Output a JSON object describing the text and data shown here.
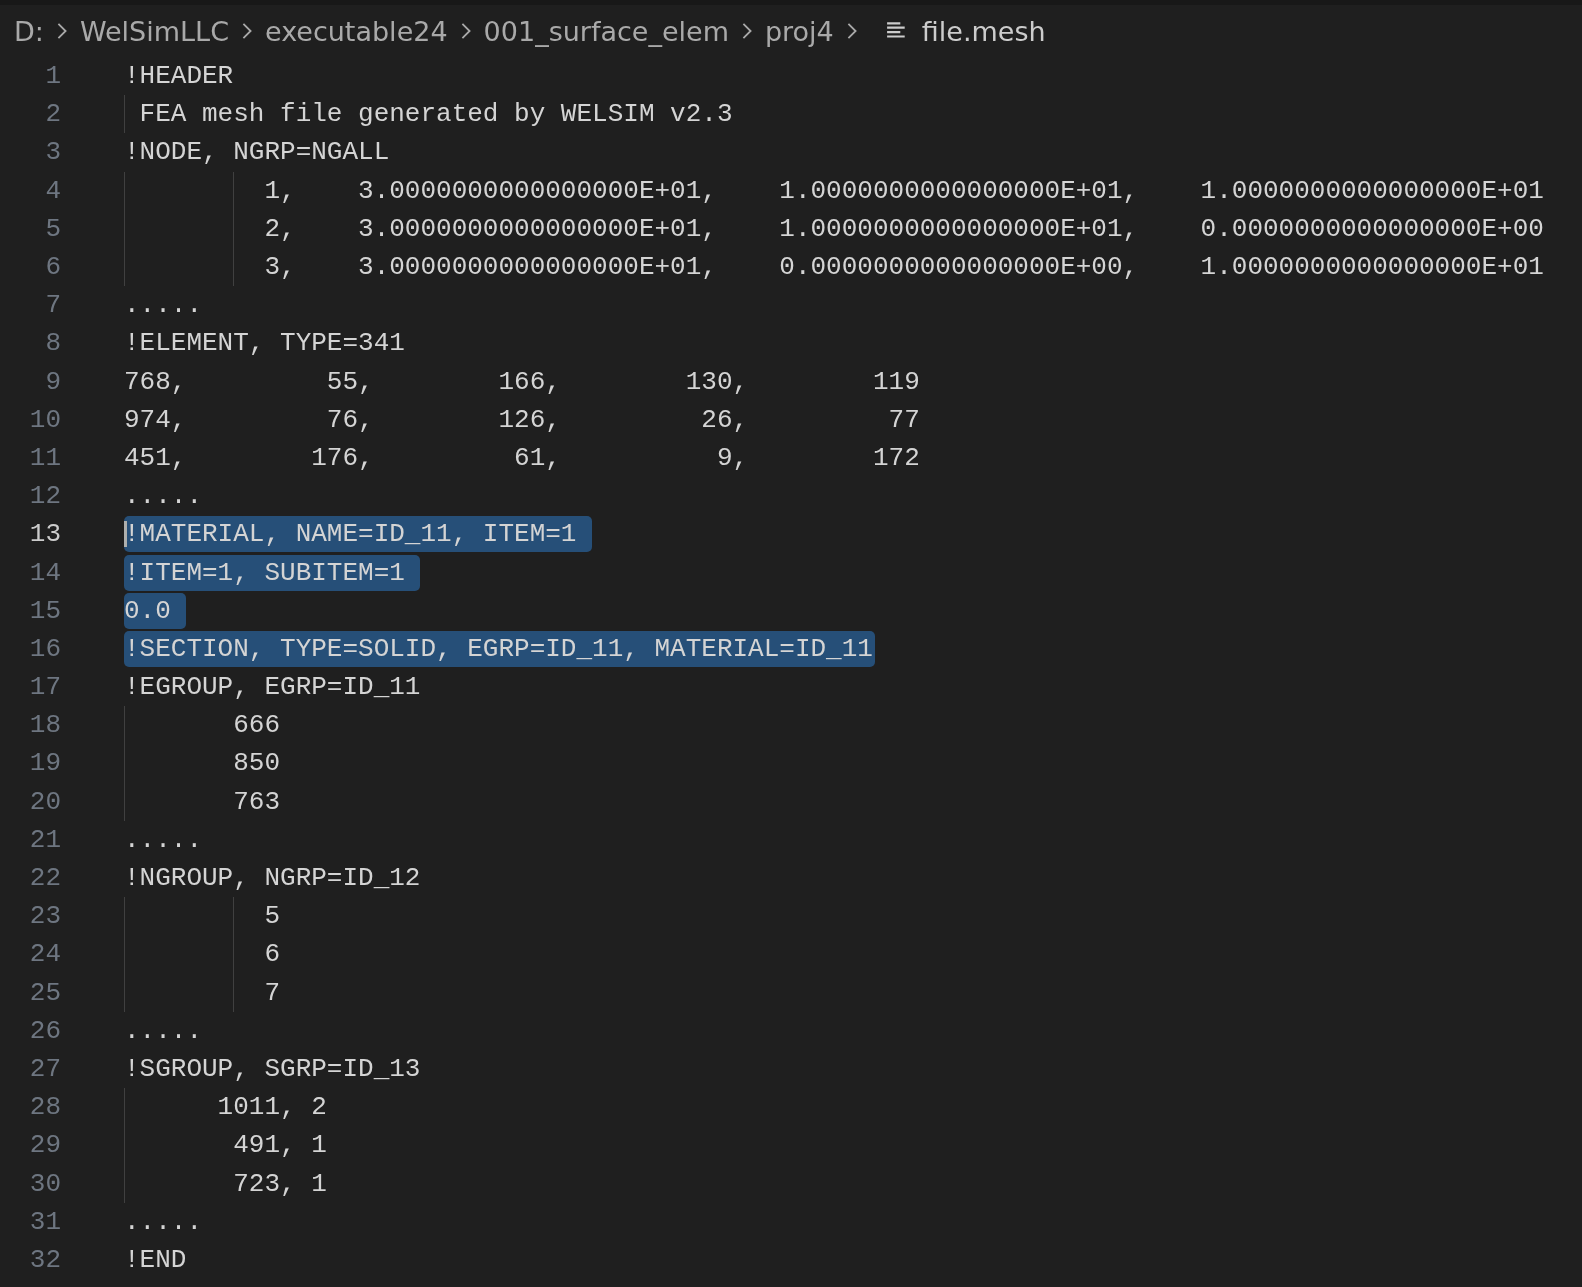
{
  "breadcrumb": [
    {
      "label": "D:",
      "kind": "folder"
    },
    {
      "label": "WelSimLLC",
      "kind": "folder"
    },
    {
      "label": "executable24",
      "kind": "folder"
    },
    {
      "label": "001_surface_elem",
      "kind": "folder"
    },
    {
      "label": "proj4",
      "kind": "folder"
    },
    {
      "label": "file.mesh",
      "kind": "file"
    }
  ],
  "lines": [
    {
      "number": "1",
      "text": "!HEADER",
      "selected": false,
      "active": false
    },
    {
      "number": "2",
      "text": " FEA mesh file generated by WELSIM v2.3",
      "selected": false,
      "active": false
    },
    {
      "number": "3",
      "text": "!NODE, NGRP=NGALL",
      "selected": false,
      "active": false
    },
    {
      "number": "4",
      "text": "         1,    3.0000000000000000E+01,    1.0000000000000000E+01,    1.0000000000000000E+01",
      "selected": false,
      "active": false
    },
    {
      "number": "5",
      "text": "         2,    3.0000000000000000E+01,    1.0000000000000000E+01,    0.0000000000000000E+00",
      "selected": false,
      "active": false
    },
    {
      "number": "6",
      "text": "         3,    3.0000000000000000E+01,    0.0000000000000000E+00,    1.0000000000000000E+01",
      "selected": false,
      "active": false
    },
    {
      "number": "7",
      "text": ".....",
      "selected": false,
      "active": false
    },
    {
      "number": "8",
      "text": "!ELEMENT, TYPE=341",
      "selected": false,
      "active": false
    },
    {
      "number": "9",
      "text": "768,         55,        166,        130,        119",
      "selected": false,
      "active": false
    },
    {
      "number": "10",
      "text": "974,         76,        126,         26,         77",
      "selected": false,
      "active": false
    },
    {
      "number": "11",
      "text": "451,        176,         61,          9,        172",
      "selected": false,
      "active": false
    },
    {
      "number": "12",
      "text": ".....",
      "selected": false,
      "active": false
    },
    {
      "number": "13",
      "text": "!MATERIAL, NAME=ID_11, ITEM=1",
      "selected": true,
      "active": true
    },
    {
      "number": "14",
      "text": "!ITEM=1, SUBITEM=1",
      "selected": true,
      "active": false
    },
    {
      "number": "15",
      "text": "0.0",
      "selected": true,
      "active": false
    },
    {
      "number": "16",
      "text": "!SECTION, TYPE=SOLID, EGRP=ID_11, MATERIAL=ID_11",
      "selected": true,
      "active": false
    },
    {
      "number": "17",
      "text": "!EGROUP, EGRP=ID_11",
      "selected": false,
      "active": false
    },
    {
      "number": "18",
      "text": "       666",
      "selected": false,
      "active": false
    },
    {
      "number": "19",
      "text": "       850",
      "selected": false,
      "active": false
    },
    {
      "number": "20",
      "text": "       763",
      "selected": false,
      "active": false
    },
    {
      "number": "21",
      "text": ".....",
      "selected": false,
      "active": false
    },
    {
      "number": "22",
      "text": "!NGROUP, NGRP=ID_12",
      "selected": false,
      "active": false
    },
    {
      "number": "23",
      "text": "         5",
      "selected": false,
      "active": false
    },
    {
      "number": "24",
      "text": "         6",
      "selected": false,
      "active": false
    },
    {
      "number": "25",
      "text": "         7",
      "selected": false,
      "active": false
    },
    {
      "number": "26",
      "text": ".....",
      "selected": false,
      "active": false
    },
    {
      "number": "27",
      "text": "!SGROUP, SGRP=ID_13",
      "selected": false,
      "active": false
    },
    {
      "number": "28",
      "text": "      1011, 2",
      "selected": false,
      "active": false
    },
    {
      "number": "29",
      "text": "       491, 1",
      "selected": false,
      "active": false
    },
    {
      "number": "30",
      "text": "       723, 1",
      "selected": false,
      "active": false
    },
    {
      "number": "31",
      "text": ".....",
      "selected": false,
      "active": false
    },
    {
      "number": "32",
      "text": "!END",
      "selected": false,
      "active": false
    }
  ]
}
